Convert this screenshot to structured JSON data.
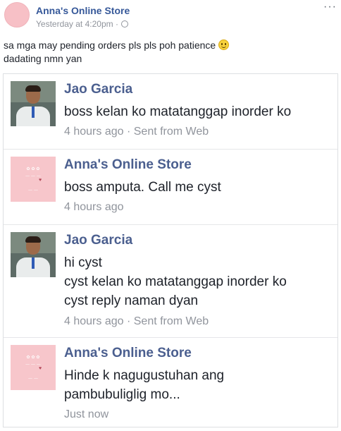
{
  "post": {
    "page_name": "Anna's Online Store",
    "time": "Yesterday at 4:20pm",
    "separator": "·",
    "privacy_icon": "globe-icon",
    "more_label": "···",
    "text_line1": "sa mga may pending orders pls pls poh patience",
    "emoji": "smiley-icon",
    "text_line2": "dadating nmn yan"
  },
  "thread": {
    "comments": [
      {
        "name": "Jao Garcia",
        "lines": [
          "boss kelan ko matatanggap inorder ko"
        ],
        "time": "4 hours ago",
        "source": "· Sent from Web"
      },
      {
        "name": "Anna's Online Store",
        "lines": [
          "boss amputa. Call me cyst"
        ],
        "time": "4 hours ago",
        "source": ""
      },
      {
        "name": "Jao Garcia",
        "lines": [
          "hi cyst",
          "cyst kelan ko matatanggap inorder ko",
          "cyst reply naman dyan"
        ],
        "time": "4 hours ago",
        "source": "· Sent from Web"
      },
      {
        "name": "Anna's Online Store",
        "lines": [
          "Hinde k nagugustuhan ang",
          "pambubuliglig mo..."
        ],
        "time": "Just now",
        "source": ""
      }
    ]
  },
  "colors": {
    "link_blue": "#365899",
    "name_blue": "#4b5f8f",
    "meta_gray": "#90949c",
    "store_pink": "#f7c6cb"
  }
}
